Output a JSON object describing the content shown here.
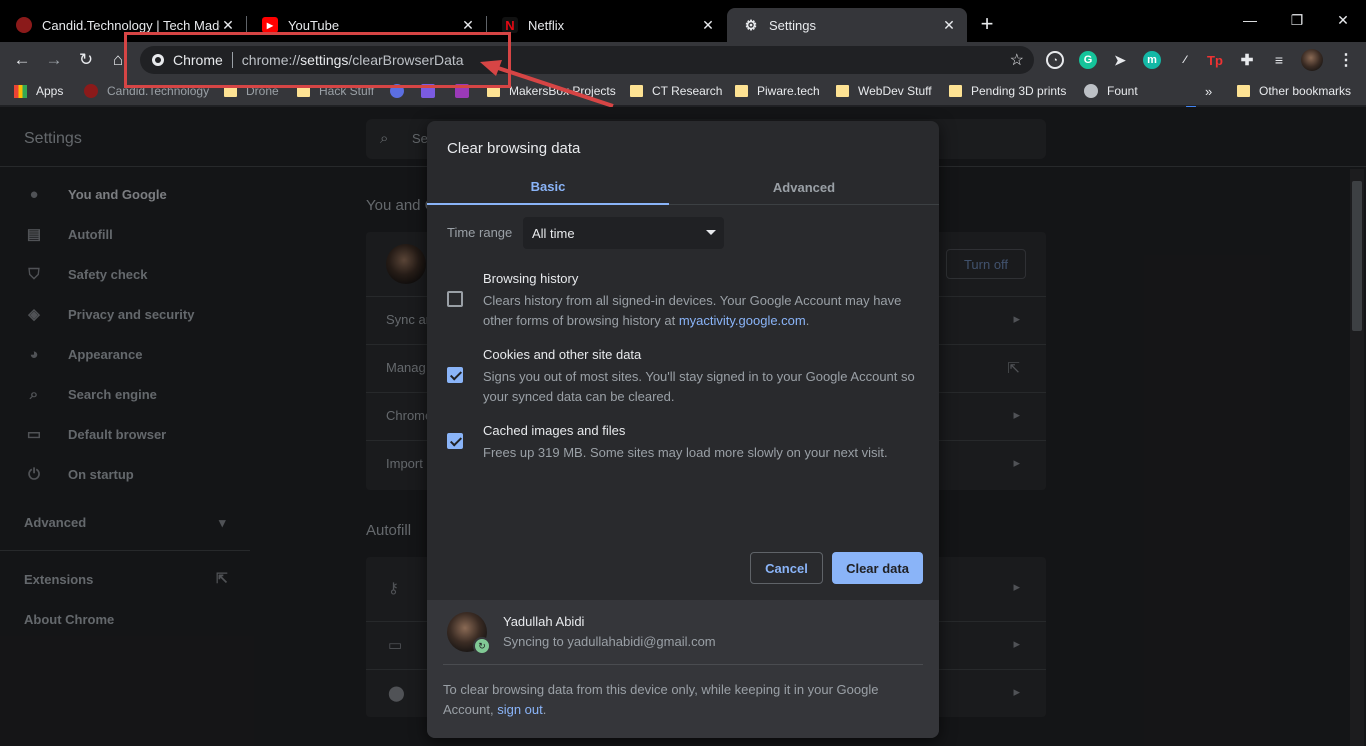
{
  "tabs": [
    {
      "title": "Candid.Technology | Tech Made S",
      "favicon": "candid-favicon",
      "color": "#8b1a1a"
    },
    {
      "title": "YouTube",
      "favicon": "youtube-favicon",
      "color": "#ff0000"
    },
    {
      "title": "Netflix",
      "favicon": "netflix-favicon",
      "color": "#e50914"
    },
    {
      "title": "Settings",
      "favicon": "gear-icon",
      "active": true
    }
  ],
  "omnibox": {
    "chip": "Chrome",
    "url_prefix": "chrome://",
    "url_host": "settings",
    "url_path": "/clearBrowserData"
  },
  "bookmarks": {
    "apps": "Apps",
    "items": [
      "Candid.Technology",
      "Drone",
      "Hack Stuff",
      "MakersBox Projects",
      "CT Research",
      "Piware.tech",
      "WebDev Stuff",
      "Pending 3D prints",
      "Fount"
    ],
    "overflow": "»",
    "other": "Other bookmarks"
  },
  "settings": {
    "title": "Settings",
    "search_placeholder": "Se",
    "nav": [
      "You and Google",
      "Autofill",
      "Safety check",
      "Privacy and security",
      "Appearance",
      "Search engine",
      "Default browser",
      "On startup"
    ],
    "advanced": "Advanced",
    "extensions": "Extensions",
    "about": "About Chrome",
    "section_you": "You and G",
    "turn_off": "Turn off",
    "rows": [
      "Sync ar",
      "Manag",
      "Chrome",
      "Import"
    ],
    "section_autofill": "Autofill"
  },
  "dialog": {
    "title": "Clear browsing data",
    "tabs": [
      "Basic",
      "Advanced"
    ],
    "time_range_label": "Time range",
    "time_range_value": "All time",
    "options": [
      {
        "title": "Browsing history",
        "desc": "Clears history from all signed-in devices. Your Google Account may have other forms of browsing history at ",
        "link": "myactivity.google.com",
        "desc_end": ".",
        "checked": false
      },
      {
        "title": "Cookies and other site data",
        "desc": "Signs you out of most sites. You'll stay signed in to your Google Account so your synced data can be cleared.",
        "checked": true
      },
      {
        "title": "Cached images and files",
        "desc": "Frees up 319 MB. Some sites may load more slowly on your next visit.",
        "checked": true
      }
    ],
    "cancel": "Cancel",
    "clear": "Clear data",
    "account_name": "Yadullah Abidi",
    "account_sync": "Syncing to yadullahabidi@gmail.com",
    "footer_note": "To clear browsing data from this device only, while keeping it in your Google Account, ",
    "footer_link": "sign out",
    "footer_end": "."
  },
  "colors": {
    "accent": "#8ab4f8",
    "annotation": "#d64545"
  }
}
